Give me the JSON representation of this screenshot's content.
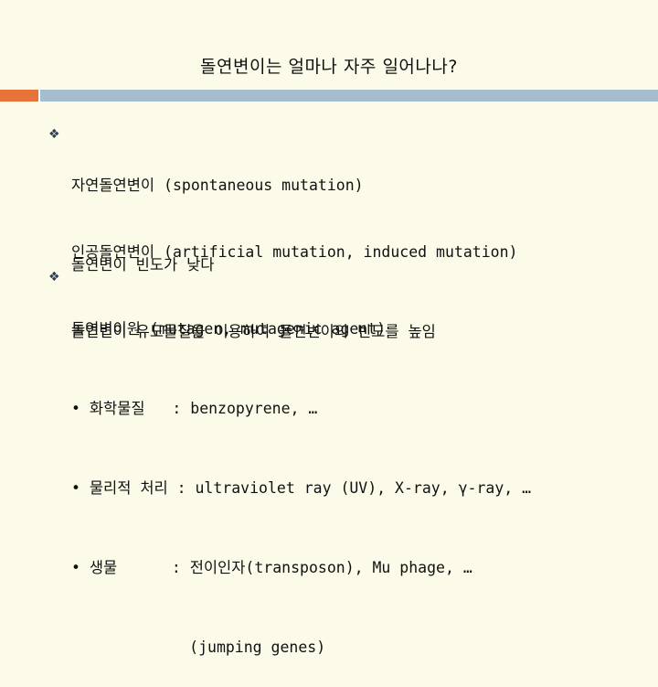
{
  "title": "돌연변이는 얼마나 자주 일어나나?",
  "section1": {
    "bullet": "❖",
    "line1": "자연돌연변이 (spontaneous mutation)",
    "line2": "돌연변이 빈도가 낮다"
  },
  "section2": {
    "line1": "인공돌연변이 (artificial mutation, induced mutation)",
    "line2": "돌연변이 유도물질을 이용하여 돌연변이의 빈도를 높임"
  },
  "section3": {
    "bullet": "❖",
    "line1": "돌연변이원 (mutagen, mutagenic agent)",
    "items": [
      "• 화학물질   : benzopyrene, …",
      "• 물리적 처리 : ultraviolet ray (UV), X-ray, γ-ray, …",
      "• 생물      : 전이인자(transposon), Mu phage, …",
      "             (jumping genes)"
    ]
  },
  "colors": {
    "background": "#fcfbe9",
    "accent_orange": "#e6733a",
    "accent_blue": "#a6bccf"
  }
}
